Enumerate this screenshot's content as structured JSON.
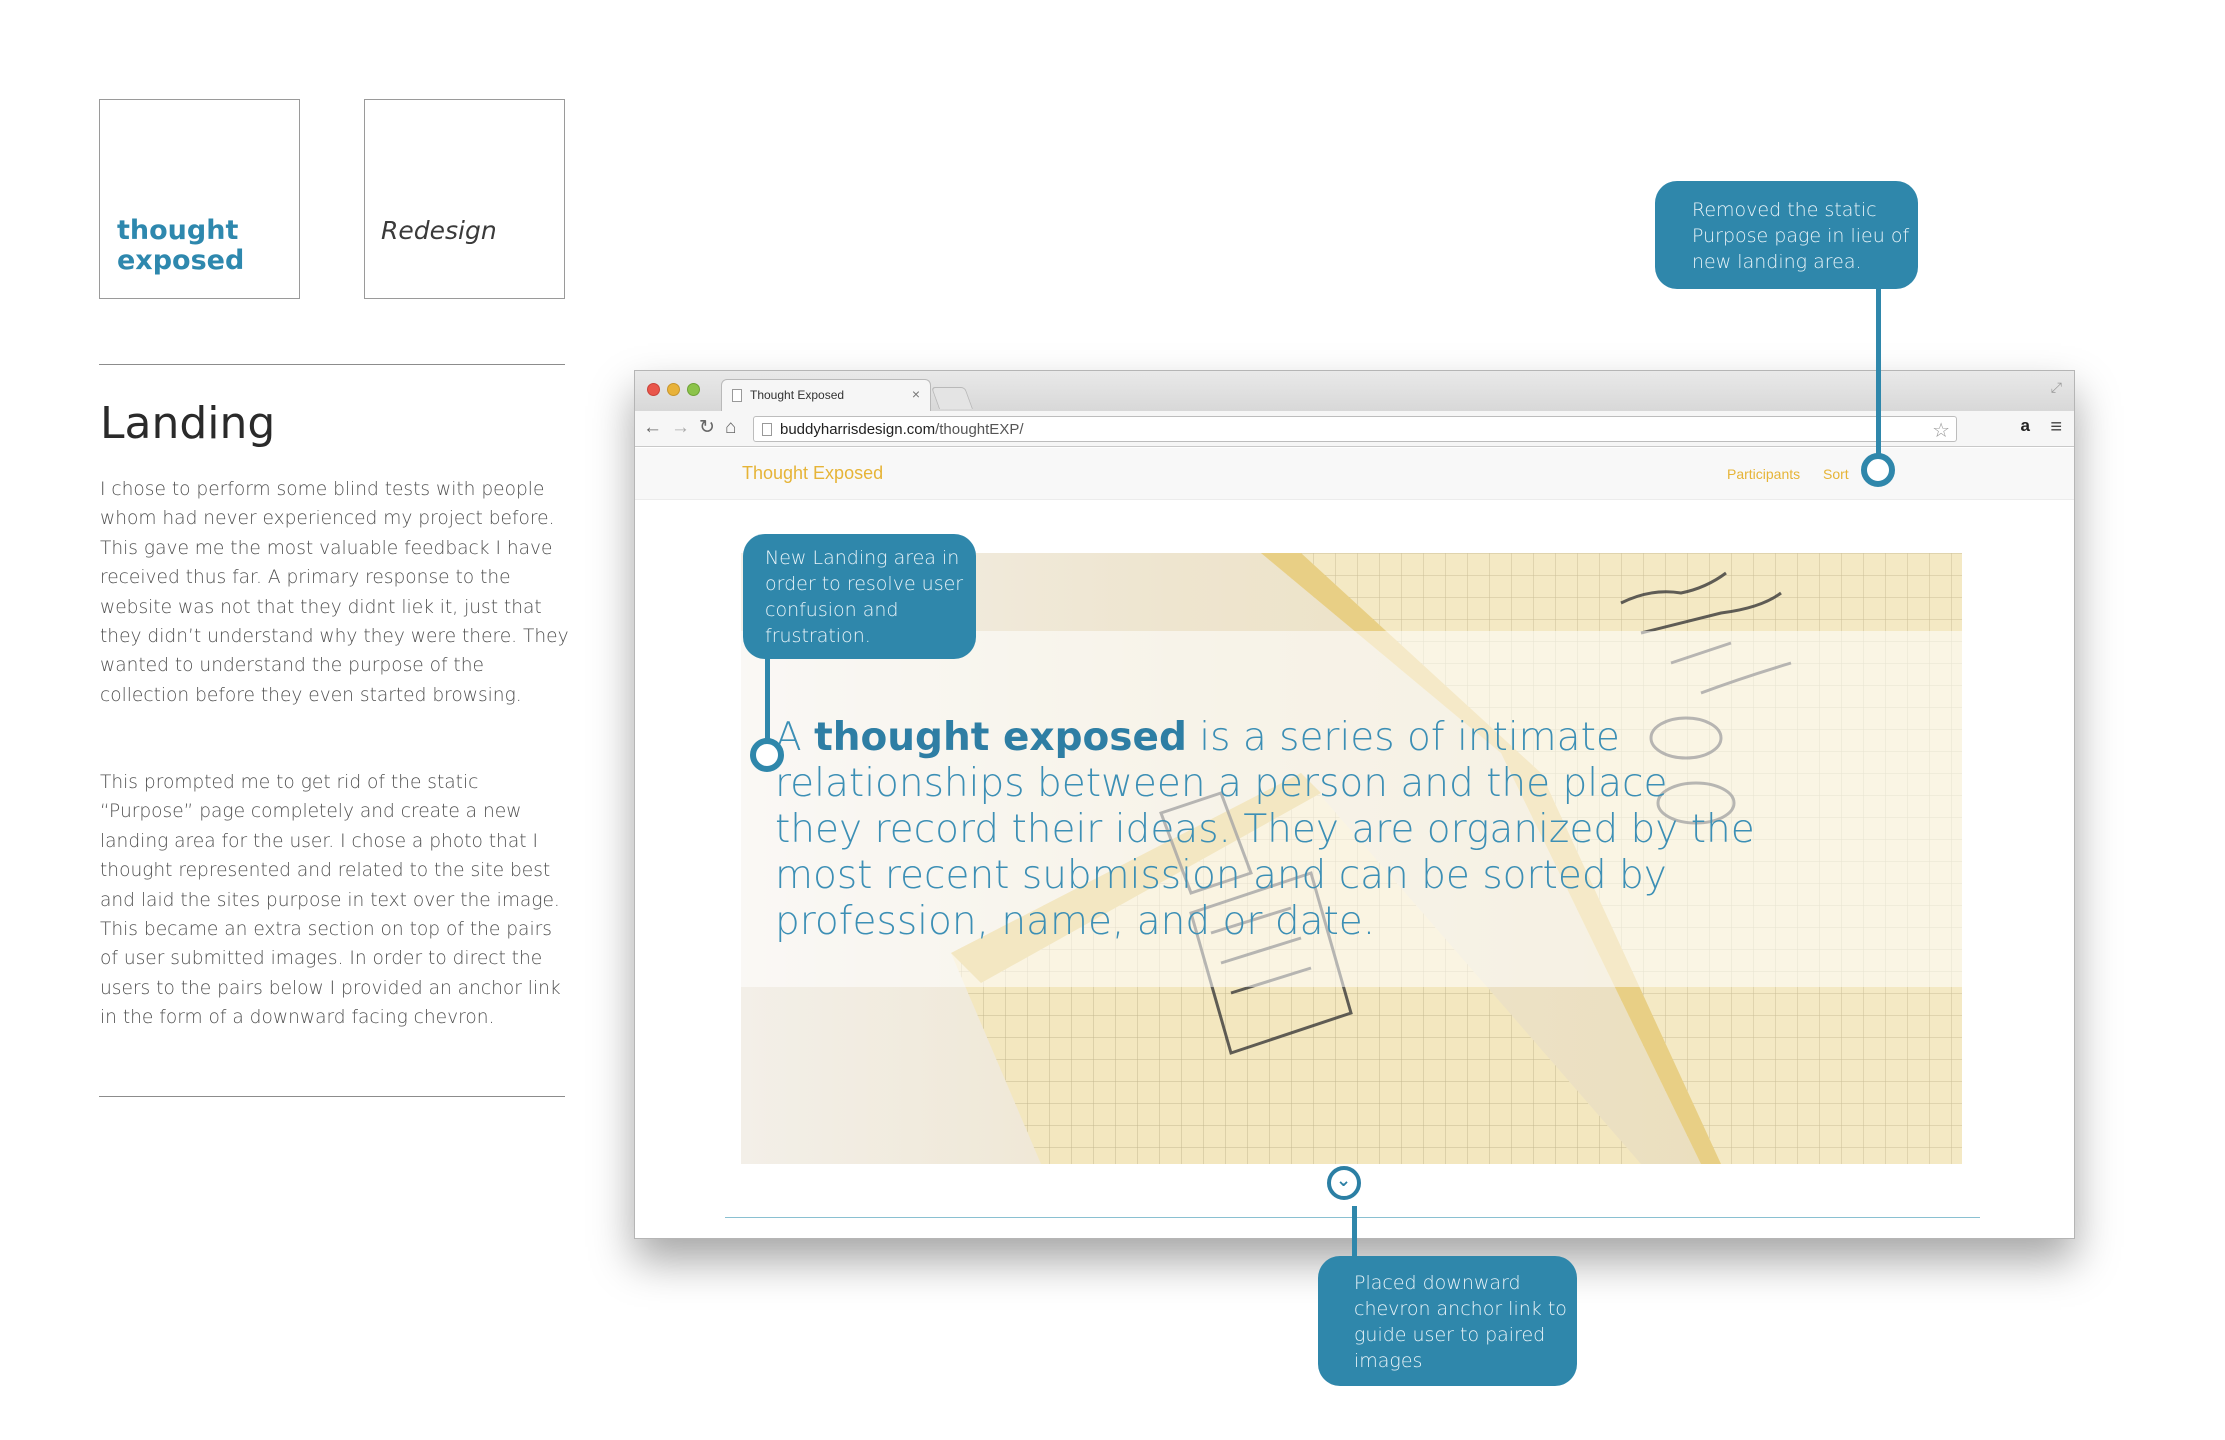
{
  "logos": {
    "thought_line1": "thought",
    "thought_line2": "exposed",
    "redesign": "Redesign"
  },
  "section": {
    "title": "Landing",
    "paragraph1": "I chose to perform some blind tests with people whom had never experienced my project before. This gave me the most valuable feedback I have received thus far. A primary response to the website was not that they didnt liek it, just that they didn’t understand why they were there. They wanted to understand the purpose of the collection before they even started browsing.",
    "paragraph2": "This prompted me to get rid of the static “Purpose” page completely and create a new landing area for the user. I chose a photo that I thought represented and related to the site best and laid the sites purpose in text over the image. This became an extra section on top of the pairs of user submitted images. In order to direct the users to the pairs below I provided an anchor link in the form of a downward facing chevron."
  },
  "browser": {
    "tab_title": "Thought Exposed",
    "tab_close": "×",
    "url_domain": "buddyharrisdesign.com",
    "url_path": "/thoughtEXP/",
    "icons": [
      "back-arrow-icon",
      "forward-arrow-icon",
      "reload-icon",
      "home-icon",
      "page-icon",
      "star-icon",
      "amazon-icon",
      "menu-icon",
      "resize-icon"
    ]
  },
  "site": {
    "brand": "Thought Exposed",
    "nav_participants": "Participants",
    "nav_sort": "Sort",
    "hero_prefix": "A",
    "hero_bold": "thought exposed",
    "hero_rest": " is a series of intimate relationships between a person and the place they record their ideas. They are organized by the most recent submission and can be sorted by profession, name, and or date."
  },
  "callouts": {
    "top_right": "Removed the static Purpose page in lieu of new landing area.",
    "hero": "New Landing area in order to resolve user confusion and frustration.",
    "bottom": "Placed downward chevron anchor link to guide user to paired images"
  },
  "colors": {
    "accent_blue": "#2f87ab",
    "brand_yellow": "#e6b437"
  }
}
